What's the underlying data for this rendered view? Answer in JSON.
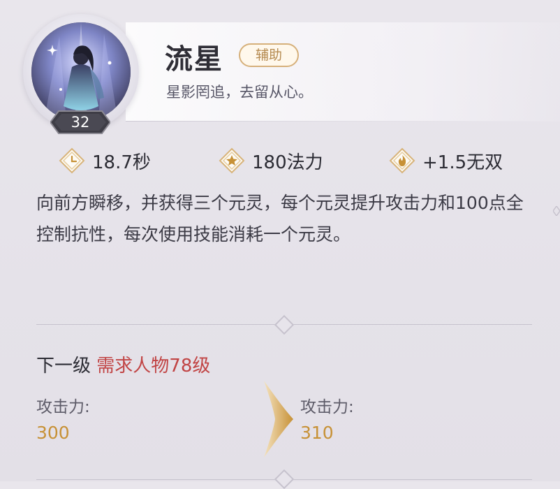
{
  "skill": {
    "name": "流星",
    "role_tag": "辅助",
    "tagline": "星影罔追，去留从心。",
    "level": "32"
  },
  "stats": [
    {
      "icon": "clock-icon",
      "value": "18.7秒"
    },
    {
      "icon": "star-icon",
      "value": "180法力"
    },
    {
      "icon": "flame-icon",
      "value": "+1.5无双"
    }
  ],
  "description": "向前方瞬移，并获得三个元灵，每个元灵提升攻击力和100点全控制抗性，每次使用技能消耗一个元灵。",
  "next_level": {
    "title": "下一级",
    "requirement": "需求人物78级",
    "current": {
      "label": "攻击力:",
      "value": "300"
    },
    "next": {
      "label": "攻击力:",
      "value": "310"
    }
  },
  "colors": {
    "accent_gold": "#c79136",
    "requirement_red": "#c14444",
    "tag_border": "#d6b07a"
  }
}
